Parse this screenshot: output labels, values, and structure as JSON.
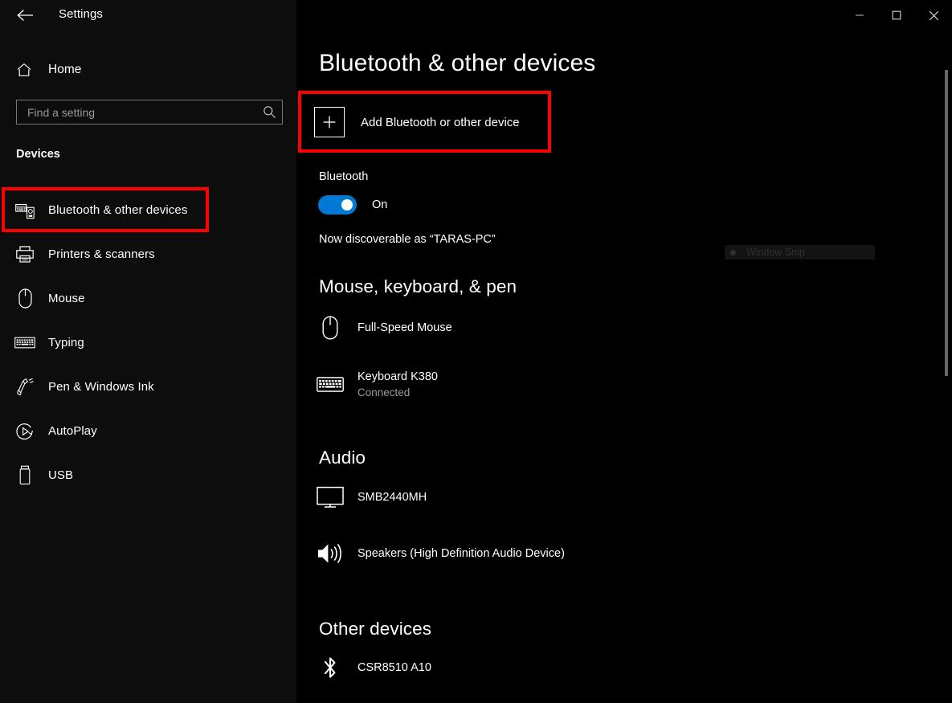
{
  "window": {
    "title": "Settings",
    "back_icon": "back-arrow-icon",
    "minimize_label": "Minimize",
    "maximize_label": "Maximize",
    "close_label": "Close"
  },
  "sidebar": {
    "home": {
      "label": "Home",
      "icon": "home-icon"
    },
    "search": {
      "value": "",
      "placeholder": "Find a setting",
      "icon": "search-icon"
    },
    "section_heading": "Devices",
    "items": [
      {
        "label": "Bluetooth & other devices",
        "icon": "bluetooth-devices-icon",
        "selected": true
      },
      {
        "label": "Printers & scanners",
        "icon": "printer-icon",
        "selected": false
      },
      {
        "label": "Mouse",
        "icon": "mouse-icon",
        "selected": false
      },
      {
        "label": "Typing",
        "icon": "keyboard-icon",
        "selected": false
      },
      {
        "label": "Pen & Windows Ink",
        "icon": "pen-icon",
        "selected": false
      },
      {
        "label": "AutoPlay",
        "icon": "autoplay-icon",
        "selected": false
      },
      {
        "label": "USB",
        "icon": "usb-icon",
        "selected": false
      }
    ]
  },
  "main": {
    "page_title": "Bluetooth & other devices",
    "add_device": {
      "label": "Add Bluetooth or other device",
      "icon": "plus-icon"
    },
    "bluetooth": {
      "label": "Bluetooth",
      "state": "On",
      "enabled": true,
      "discoverable_text": "Now discoverable as “TARAS-PC”"
    },
    "overlay": {
      "label": "Window Snip",
      "icon": "record-dot-icon"
    },
    "groups": [
      {
        "title": "Mouse, keyboard, & pen",
        "devices": [
          {
            "name": "Full-Speed Mouse",
            "status": "",
            "icon": "mouse-icon"
          },
          {
            "name": "Keyboard K380",
            "status": "Connected",
            "icon": "keyboard-icon"
          }
        ]
      },
      {
        "title": "Audio",
        "devices": [
          {
            "name": "SMB2440MH",
            "status": "",
            "icon": "monitor-icon"
          },
          {
            "name": "Speakers (High Definition Audio Device)",
            "status": "",
            "icon": "speaker-icon"
          }
        ]
      },
      {
        "title": "Other devices",
        "devices": [
          {
            "name": "CSR8510 A10",
            "status": "",
            "icon": "bluetooth-icon"
          }
        ]
      }
    ]
  },
  "colors": {
    "accent": "#0078d4",
    "highlight": "#fe0000",
    "sidebar_bg": "#0d0d0d",
    "content_bg": "#000000",
    "text": "#ffffff",
    "muted_text": "#9b9b9b"
  }
}
